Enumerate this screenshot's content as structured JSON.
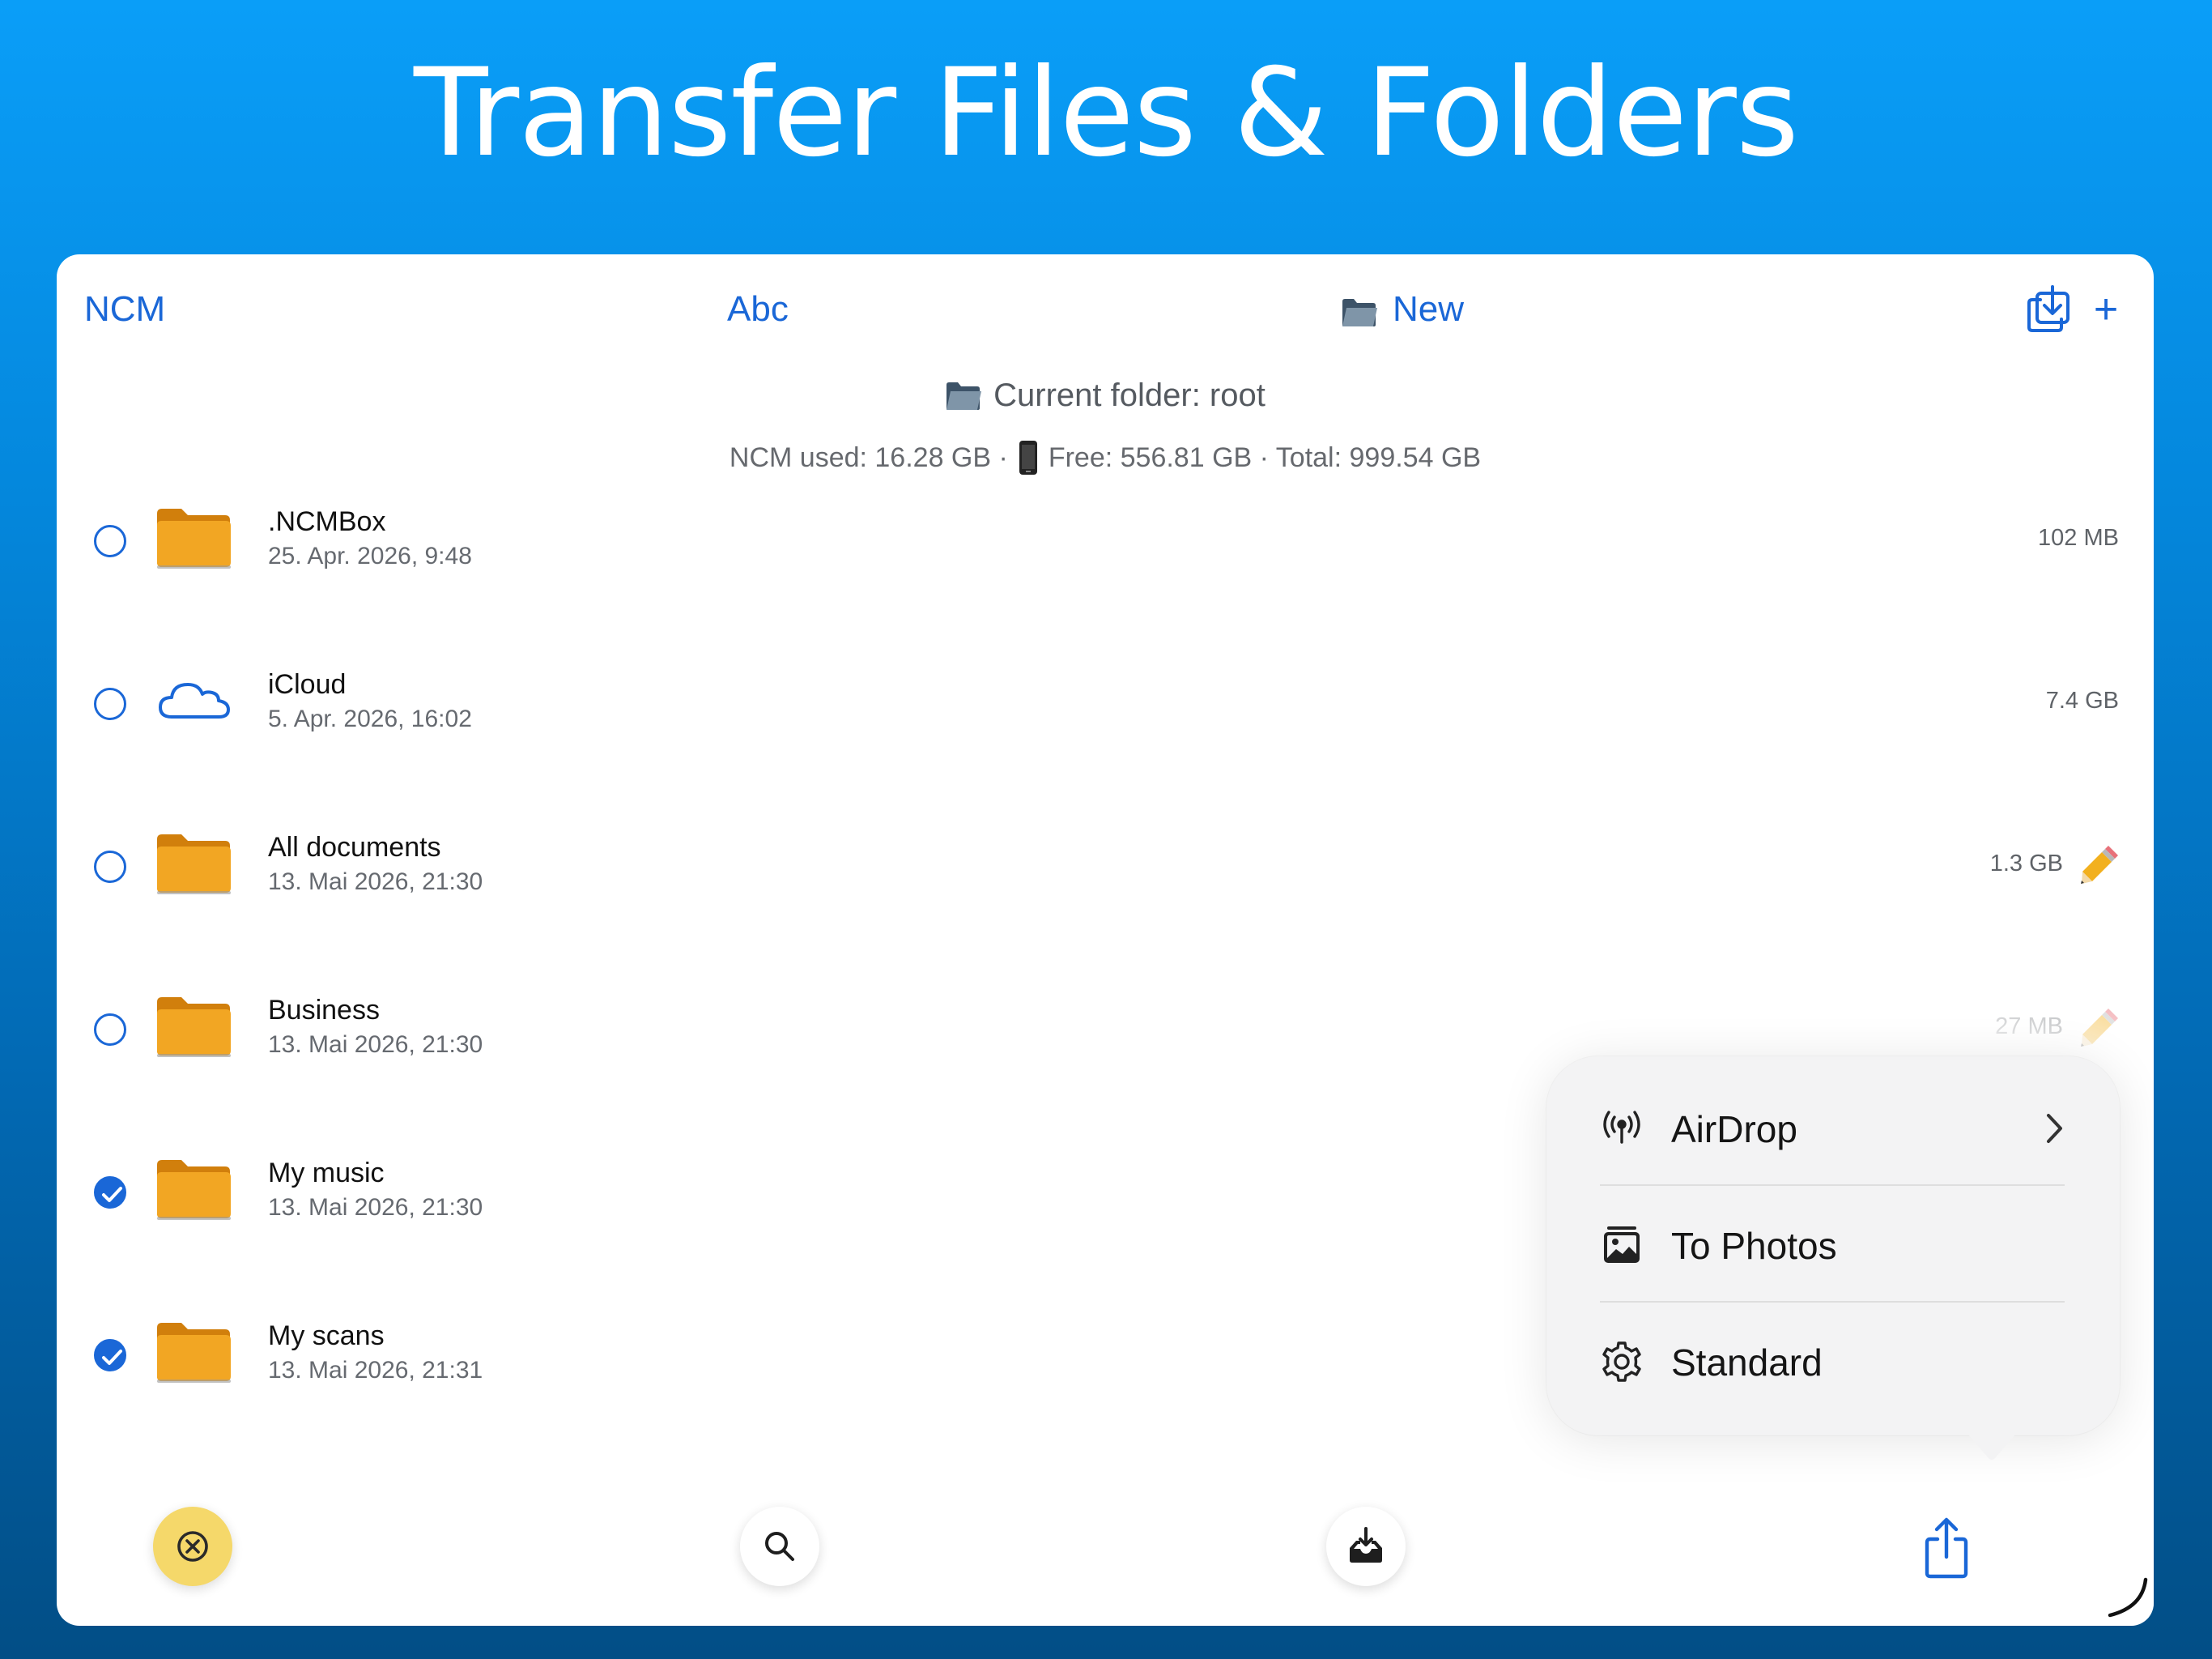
{
  "headline": "Transfer Files & Folders",
  "toolbar": {
    "ncm_label": "NCM",
    "sort_label": "Abc",
    "new_label": "New",
    "plus_label": "+"
  },
  "location": {
    "current_folder": "Current folder: root",
    "ncm_used": "NCM used: 16.28 GB ·",
    "free_total": "Free: 556.81 GB · Total: 999.54 GB"
  },
  "files": [
    {
      "name": ".NCMBox",
      "date": "25. Apr. 2026, 9:48",
      "size": "102 MB",
      "icon": "folder-icon",
      "selected": false,
      "editable": false
    },
    {
      "name": "iCloud",
      "date": "5. Apr. 2026, 16:02",
      "size": "7.4 GB",
      "icon": "cloud-icon",
      "selected": false,
      "editable": false
    },
    {
      "name": "All documents",
      "date": "13. Mai 2026, 21:30",
      "size": "1.3 GB",
      "icon": "folder-icon",
      "selected": false,
      "editable": true
    },
    {
      "name": "Business",
      "date": "13. Mai 2026, 21:30",
      "size": "27 MB",
      "icon": "folder-icon",
      "selected": false,
      "editable": true
    },
    {
      "name": "My music",
      "date": "13. Mai 2026, 21:30",
      "size": "",
      "icon": "folder-icon",
      "selected": true,
      "editable": true
    },
    {
      "name": "My scans",
      "date": "13. Mai 2026, 21:31",
      "size": "",
      "icon": "folder-icon",
      "selected": true,
      "editable": true
    }
  ],
  "share_menu": {
    "items": [
      {
        "label": "AirDrop",
        "icon": "airdrop-icon",
        "submenu": true
      },
      {
        "label": "To Photos",
        "icon": "photos-icon",
        "submenu": false
      },
      {
        "label": "Standard",
        "icon": "gear-icon",
        "submenu": false
      }
    ]
  },
  "colors": {
    "accent": "#1a67d7",
    "folder": "#f0a01e",
    "cancel_button": "#f5d86a",
    "background_top": "#0a9ef8",
    "background_bottom": "#024e86"
  }
}
